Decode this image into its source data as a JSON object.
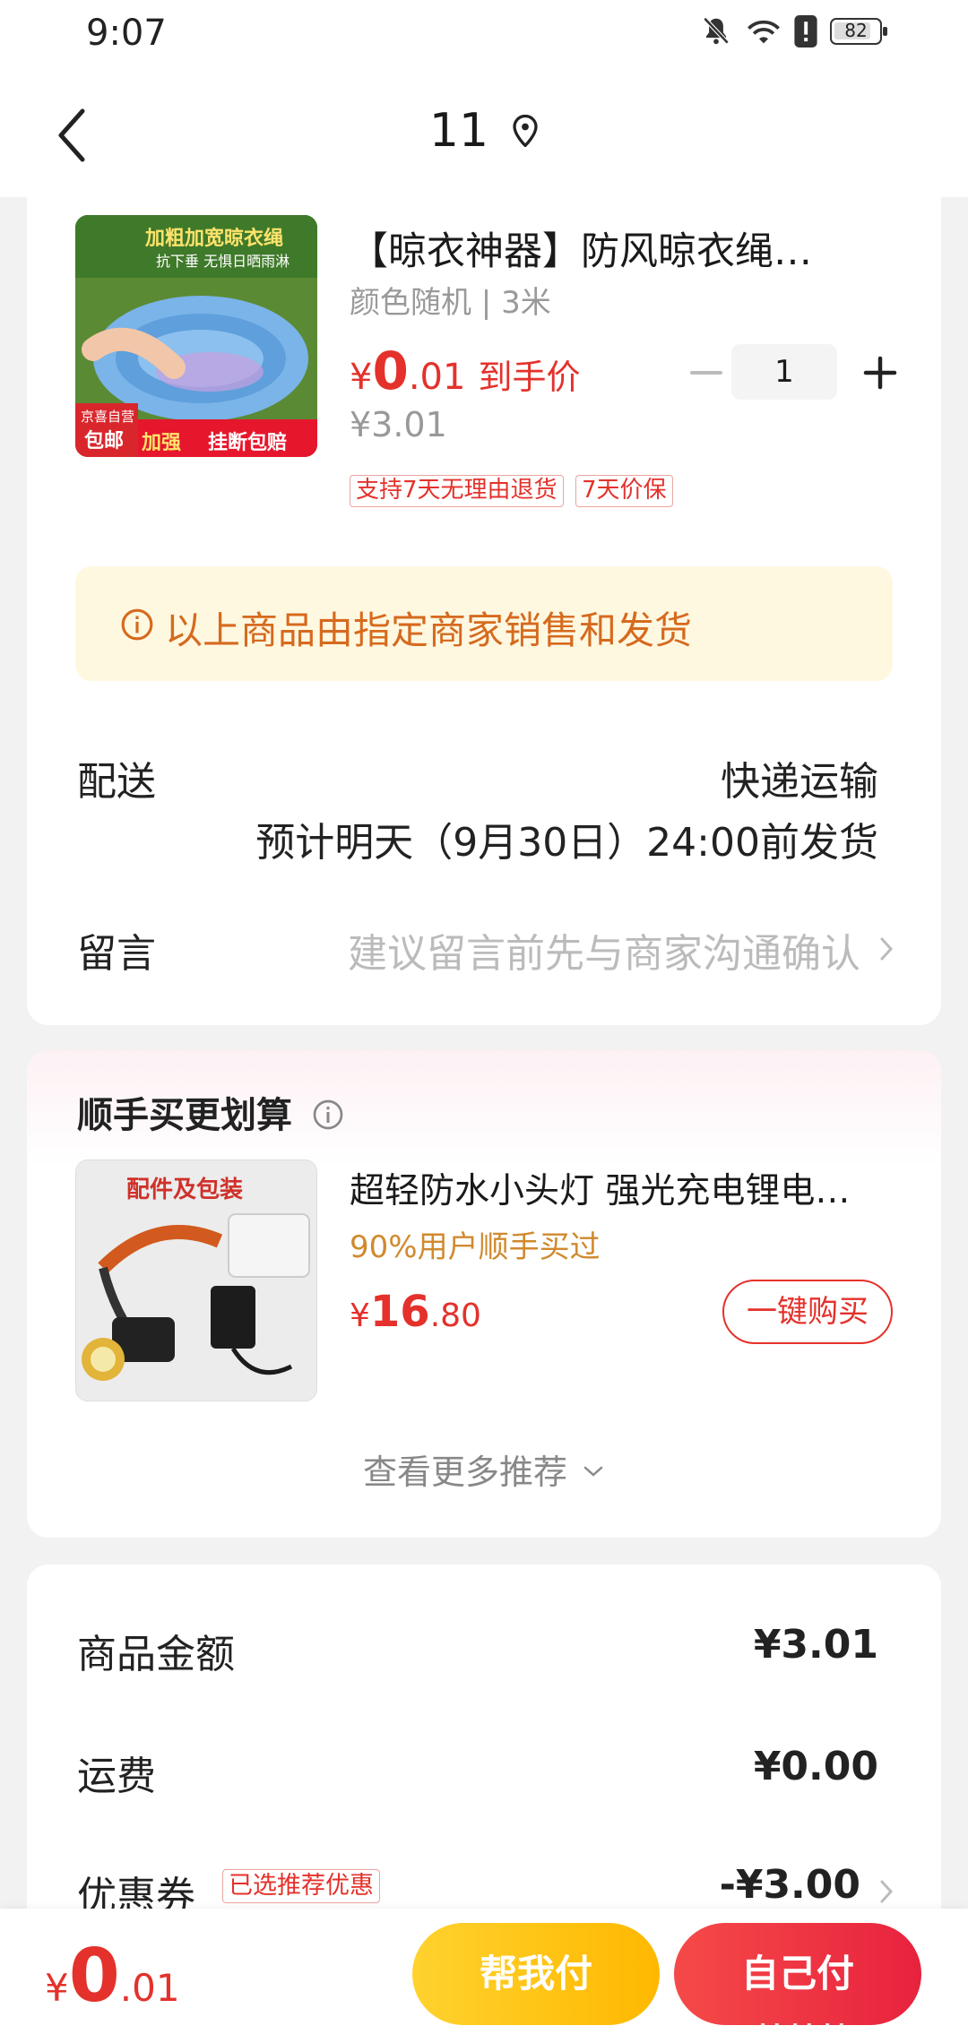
{
  "status": {
    "time": "9:07",
    "battery": "82"
  },
  "nav": {
    "title": "11"
  },
  "product": {
    "title": "【晾衣神器】防风晾衣绳…",
    "spec": "颜色随机 | 3米",
    "price_symbol": "¥",
    "price_big": "0",
    "price_small": ".01",
    "price_label": "到手价",
    "original_price": "¥3.01",
    "quantity": "1",
    "tags": [
      "支持7天无理由退货",
      "7天价保"
    ],
    "image_text": {
      "top": "加粗加宽晾衣绳",
      "sub": "抗下垂 无惧日晒雨淋",
      "badge1": "京喜自营",
      "badge2": "包邮",
      "bottom1": "加强",
      "bottom2": "挂断包赔"
    }
  },
  "notice": {
    "text": "以上商品由指定商家销售和发货"
  },
  "delivery": {
    "label": "配送",
    "method": "快递运输",
    "estimate": "预计明天（9月30日）24:00前发货"
  },
  "message": {
    "label": "留言",
    "placeholder": "建议留言前先与商家沟通确认"
  },
  "recommend": {
    "title": "顺手买更划算",
    "item": {
      "title": "超轻防水小头灯 强光充电锂电…",
      "subtitle": "90%用户顺手买过",
      "price_symbol": "¥",
      "price_big": "16",
      "price_small": ".80",
      "buy_label": "一键购买",
      "image_text": "配件及包装"
    },
    "more": "查看更多推荐"
  },
  "summary": {
    "goods_label": "商品金额",
    "goods_value": "¥3.01",
    "shipping_label": "运费",
    "shipping_value": "¥0.00",
    "coupon_label": "优惠券",
    "coupon_tag": "已选推荐优惠",
    "coupon_value": "-¥3.00"
  },
  "bottom": {
    "total_symbol": "¥",
    "total_big": "0",
    "total_small": ".01",
    "help_pay": "帮我付",
    "self_pay": "自己付",
    "watermark": "zhizhizhi.com"
  },
  "colors": {
    "accent": "#e4312b",
    "notice_bg": "#fff8e1",
    "notice_text": "#d66a1e",
    "yellow": "#ffc21a"
  }
}
